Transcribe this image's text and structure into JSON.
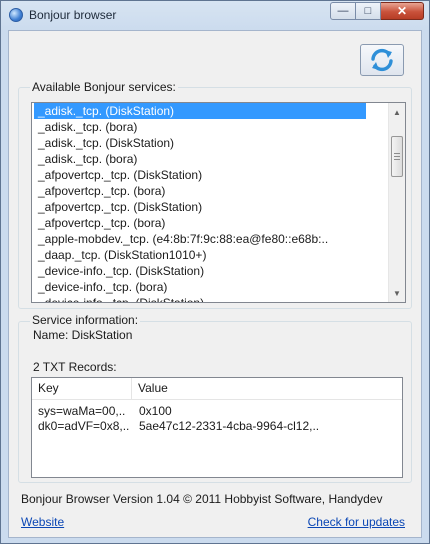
{
  "window": {
    "title": "Bonjour browser",
    "caption_buttons": {
      "minimize": "—",
      "maximize": "□",
      "close": "✕"
    }
  },
  "toolbar": {
    "refresh_icon": "refresh-icon"
  },
  "services": {
    "label": "Available Bonjour services:",
    "items": [
      "_adisk._tcp. (DiskStation)",
      "_adisk._tcp. (bora)",
      "_adisk._tcp. (DiskStation)",
      "_adisk._tcp. (bora)",
      "_afpovertcp._tcp. (DiskStation)",
      "_afpovertcp._tcp. (bora)",
      "_afpovertcp._tcp. (DiskStation)",
      "_afpovertcp._tcp. (bora)",
      "_apple-mobdev._tcp. (e4:8b:7f:9c:88:ea@fe80::e68b:..",
      "_daap._tcp. (DiskStation1010+)",
      "_device-info._tcp. (DiskStation)",
      "_device-info._tcp. (bora)",
      "_device-info._tcp. (DiskStation)"
    ],
    "selected_index": 0
  },
  "service_info": {
    "label": "Service information:",
    "name_line": "Name: DiskStation",
    "txt_records_title": "2 TXT Records:",
    "columns": {
      "key": "Key",
      "value": "Value"
    },
    "records": [
      {
        "key": "sys=waMa=00,..",
        "value": "0x100"
      },
      {
        "key": "dk0=adVF=0x8,..",
        "value": "5ae47c12-2331-4cba-9964-cl12,.."
      }
    ]
  },
  "footer": {
    "version": "Bonjour Browser Version 1.04 © 2011 Hobbyist Software, Handydev",
    "website_link": "Website",
    "updates_link": "Check for updates"
  },
  "colors": {
    "selection": "#3399ff",
    "link": "#0b47b5",
    "close_button": "#c9523b"
  }
}
